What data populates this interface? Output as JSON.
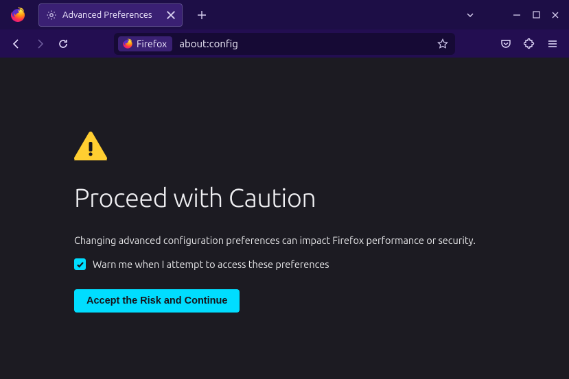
{
  "tab": {
    "title": "Advanced Preferences"
  },
  "urlbar": {
    "identity_label": "Firefox",
    "url": "about:config"
  },
  "warning": {
    "heading": "Proceed with Caution",
    "description": "Changing advanced configuration preferences can impact Firefox performance or security.",
    "checkbox_label": "Warn me when I attempt to access these preferences",
    "checkbox_checked": true,
    "accept_button": "Accept the Risk and Continue"
  }
}
